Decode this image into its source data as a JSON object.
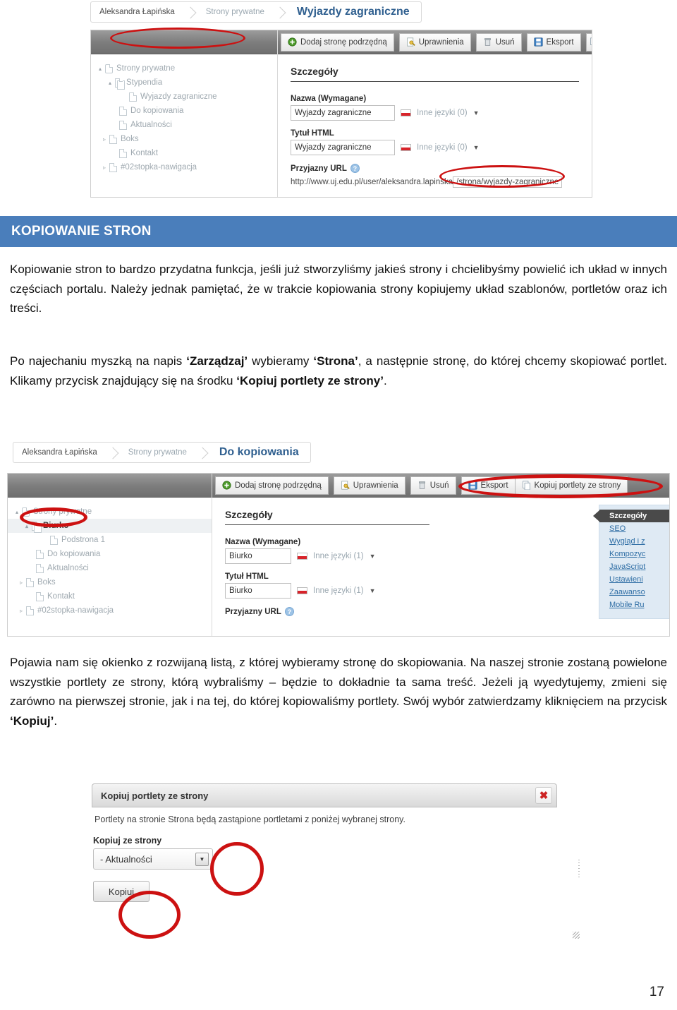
{
  "document": {
    "heading": "KOPIOWANIE STRON",
    "page_number": "17",
    "paragraphs": {
      "p1_part1": "Kopiowanie stron to bardzo przydatna funkcja, jeśli już stworzyliśmy jakieś strony i chcielibyśmy powielić ich układ w innych częściach portalu. Należy jednak pamiętać, że w trakcie kopiowania strony kopiujemy układ szablonów, portletów oraz ich treści.",
      "p2_a": "Po najechaniu myszką na napis ",
      "p2_b1": "‘Zarządzaj’",
      "p2_c": " wybieramy ",
      "p2_b2": "‘Strona’",
      "p2_d": ", a następnie stronę, do której chcemy skopiować portlet. Klikamy przycisk znajdujący się na środku ",
      "p2_b3": "‘Kopiuj portlety ze strony’",
      "p2_e": ".",
      "p3_a": "Pojawia nam się okienko z rozwijaną listą, z której wybieramy stronę do skopiowania. Na naszej stronie zostaną powielone wszystkie portlety ze strony, którą wybraliśmy – będzie to dokładnie ta sama treść. Jeżeli ją wyedytujemy, zmieni się zarówno na pierwszej stronie, jak i na tej, do której kopiowaliśmy portlety. Swój wybór zatwierdzamy kliknięciem na przycisk ",
      "p3_b": "‘Kopiuj’",
      "p3_c": "."
    },
    "colors": {
      "heading_bar": "#4a7ebb",
      "annotation": "#cc1111",
      "link": "#2f6ea5"
    }
  },
  "screenshot1": {
    "breadcrumb": {
      "user": "Aleksandra Łapińska",
      "section": "Strony prywatne",
      "current": "Wyjazdy zagraniczne"
    },
    "toolbar": [
      {
        "label": "Dodaj stronę podrzędną",
        "icon": "plus-circle-icon"
      },
      {
        "label": "Uprawnienia",
        "icon": "key-page-icon"
      },
      {
        "label": "Usuń",
        "icon": "trash-icon"
      },
      {
        "label": "Eksport",
        "icon": "floppy-disk-icon"
      }
    ],
    "tree": [
      {
        "label": "Strony prywatne",
        "indent": 0,
        "twisty": "▴",
        "icon": "globe-page-icon",
        "selected": false
      },
      {
        "label": "Stypendia",
        "indent": 1,
        "twisty": "▴",
        "icon": "stack-page-icon",
        "selected": false
      },
      {
        "label": "Wyjazdy zagraniczne",
        "indent": 2,
        "twisty": "",
        "icon": "page-icon",
        "selected": false
      },
      {
        "label": "Do kopiowania",
        "indent": 1,
        "twisty": "",
        "icon": "page-icon",
        "selected": false
      },
      {
        "label": "Aktualności",
        "indent": 1,
        "twisty": "",
        "icon": "page-icon",
        "selected": false
      },
      {
        "label": "Boks",
        "indent": 1,
        "twisty": "▹",
        "icon": "page-icon",
        "selected": false
      },
      {
        "label": "Kontakt",
        "indent": 1,
        "twisty": "",
        "icon": "page-icon",
        "selected": false
      },
      {
        "label": "#02stopka-nawigacja",
        "indent": 1,
        "twisty": "▹",
        "icon": "page-icon",
        "selected": false
      }
    ],
    "details": {
      "section_title": "Szczegóły",
      "name_label": "Nazwa (Wymagane)",
      "name_value": "Wyjazdy zagraniczne",
      "name_langs": "Inne języki (0)",
      "title_label": "Tytuł HTML",
      "title_value": "Wyjazdy zagraniczne",
      "title_langs": "Inne języki (0)",
      "url_label": "Przyjazny URL",
      "url_prefix": "http://www.uj.edu.pl/user/aleksandra.lapinska",
      "url_value": "/strona/wyjazdy-zagraniczne"
    }
  },
  "screenshot2": {
    "breadcrumb": {
      "user": "Aleksandra Łapińska",
      "section": "Strony prywatne",
      "current": "Do kopiowania"
    },
    "toolbar": [
      {
        "label": "Dodaj stronę podrzędną",
        "icon": "plus-circle-icon"
      },
      {
        "label": "Uprawnienia",
        "icon": "key-page-icon"
      },
      {
        "label": "Usuń",
        "icon": "trash-icon"
      },
      {
        "label": "Eksport",
        "icon": "floppy-disk-icon"
      },
      {
        "label": "Kopiuj portlety ze strony",
        "icon": "copy-pages-icon"
      }
    ],
    "tree": [
      {
        "label": "Strony prywatne",
        "indent": 0,
        "twisty": "▴",
        "icon": "globe-page-icon",
        "selected": false
      },
      {
        "label": "Biurko",
        "indent": 1,
        "twisty": "▴",
        "icon": "stack-page-icon",
        "selected": true
      },
      {
        "label": "Podstrona 1",
        "indent": 2,
        "twisty": "",
        "icon": "page-icon",
        "selected": false
      },
      {
        "label": "Do kopiowania",
        "indent": 1,
        "twisty": "",
        "icon": "page-icon",
        "selected": false
      },
      {
        "label": "Aktualności",
        "indent": 1,
        "twisty": "",
        "icon": "page-icon",
        "selected": false
      },
      {
        "label": "Boks",
        "indent": 1,
        "twisty": "▹",
        "icon": "page-icon",
        "selected": false
      },
      {
        "label": "Kontakt",
        "indent": 1,
        "twisty": "",
        "icon": "page-icon",
        "selected": false
      },
      {
        "label": "#02stopka-nawigacja",
        "indent": 1,
        "twisty": "▹",
        "icon": "page-icon",
        "selected": false
      }
    ],
    "details": {
      "section_title": "Szczegóły",
      "name_label": "Nazwa (Wymagane)",
      "name_value": "Biurko",
      "name_langs": "Inne języki (1)",
      "title_label": "Tytuł HTML",
      "title_value": "Biurko",
      "title_langs": "Inne języki (1)",
      "url_label": "Przyjazny URL"
    },
    "side_nav": {
      "active": "Szczegóły",
      "items": [
        "SEO",
        "Wygląd i z",
        "Kompozyc",
        "JavaScript",
        "Ustawieni",
        "Zaawanso",
        "Mobile Ru"
      ]
    }
  },
  "dialog": {
    "title": "Kopiuj portlety ze strony",
    "close_label": "✖",
    "message": "Portlety na stronie Strona będą zastąpione portletami z poniżej wybranej strony.",
    "select_label": "Kopiuj ze strony",
    "select_value": "- Aktualności",
    "submit_label": "Kopiuj"
  }
}
